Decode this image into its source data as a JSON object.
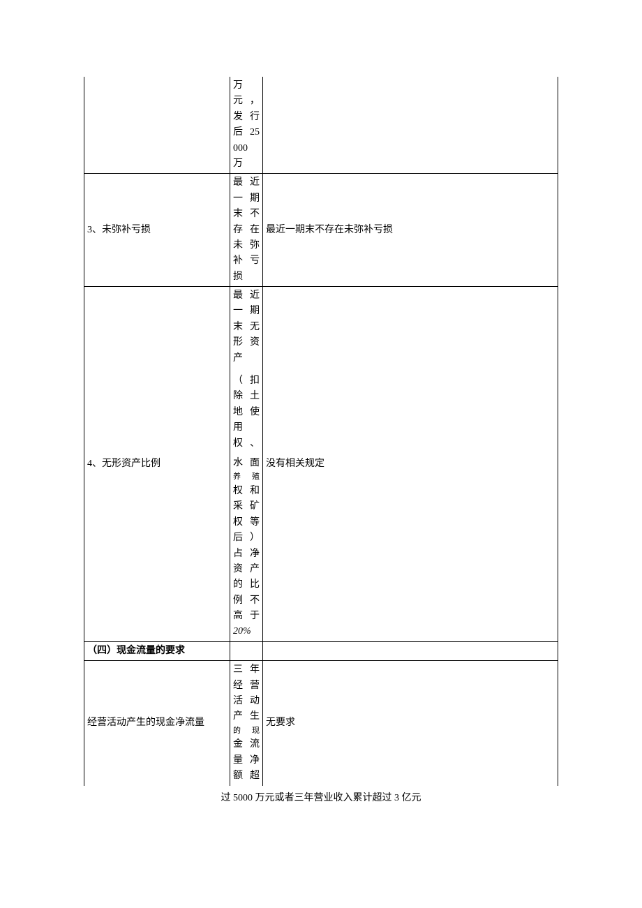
{
  "rows": {
    "r1_col2": "万元，发行后 25000 万",
    "r2_col1": "3、未弥补亏损",
    "r2_col2": "最近一期末不存在未弥补亏损",
    "r2_col3": "最近一期末不存在未弥补亏损",
    "r3_col1": "4、无形资产比例",
    "r3_col2_a": "最近一期末无形资产",
    "r3_col2_b": "（扣除土地使用权、",
    "r3_col2_c": "水面",
    "r3_col2_d": "养殖",
    "r3_col2_e": "权和采矿权等后）占净资产的比例不高于",
    "r3_col2_f": "20%",
    "r3_col3": "没有相关规定",
    "r4_col1": "（四）现金流量的要求",
    "r5_col1": "经营活动产生的现金净流量",
    "r5_col2_a": "三年经营活动产生",
    "r5_col2_b": "的现",
    "r5_col2_c": "金流量净额超",
    "r5_col3": "无要求"
  },
  "footer": "过 5000 万元或者三年营业收入累计超过 3 亿元"
}
